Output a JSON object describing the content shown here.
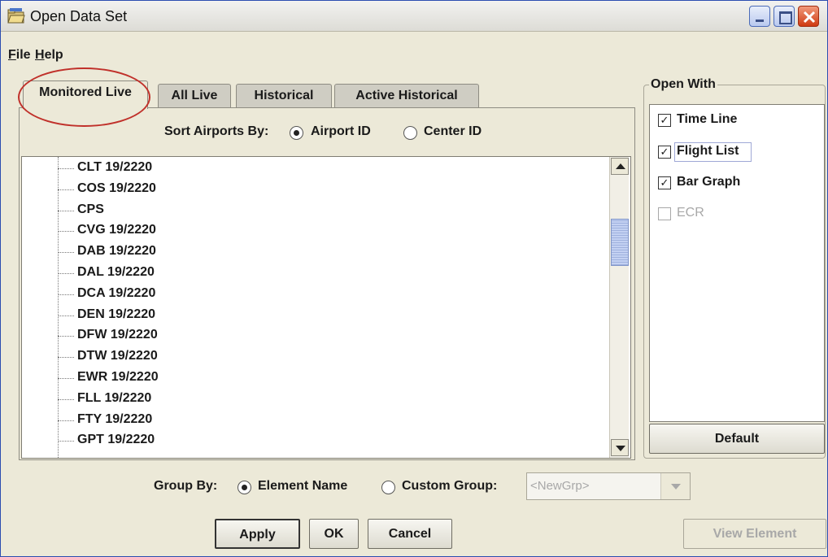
{
  "window": {
    "title": "Open Data Set",
    "icon": "folder-open-icon"
  },
  "menu": {
    "file": "File",
    "help": "Help"
  },
  "tabs": [
    {
      "label": "Monitored Live",
      "active": true
    },
    {
      "label": "All Live",
      "active": false
    },
    {
      "label": "Historical",
      "active": false
    },
    {
      "label": "Active Historical",
      "active": false
    }
  ],
  "sort": {
    "label": "Sort Airports By:",
    "options": [
      {
        "label": "Airport ID",
        "selected": true
      },
      {
        "label": "Center ID",
        "selected": false
      }
    ]
  },
  "airports": [
    "CLT 19/2220",
    "COS 19/2220",
    "CPS",
    "CVG 19/2220",
    "DAB 19/2220",
    "DAL 19/2220",
    "DCA 19/2220",
    "DEN 19/2220",
    "DFW 19/2220",
    "DTW 19/2220",
    "EWR 19/2220",
    "FLL 19/2220",
    "FTY 19/2220",
    "GPT 19/2220"
  ],
  "open_with": {
    "title": "Open With",
    "items": [
      {
        "label": "Time Line",
        "checked": true,
        "enabled": true
      },
      {
        "label": "Flight List",
        "checked": true,
        "enabled": true
      },
      {
        "label": "Bar Graph",
        "checked": true,
        "enabled": true
      },
      {
        "label": "ECR",
        "checked": false,
        "enabled": false
      }
    ],
    "default_button": "Default"
  },
  "group_by": {
    "label": "Group By:",
    "element_name": "Element Name",
    "custom_group": "Custom Group:",
    "combo_value": "<NewGrp>"
  },
  "buttons": {
    "apply": "Apply",
    "ok": "OK",
    "cancel": "Cancel",
    "view_element": "View Element"
  },
  "colors": {
    "highlight_oval": "#c0302a",
    "window_bg": "#ece9d8"
  }
}
